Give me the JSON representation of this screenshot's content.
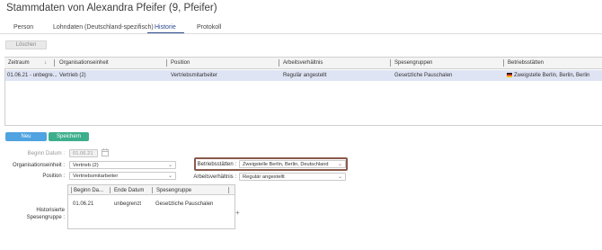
{
  "header": {
    "title": "Stammdaten von Alexandra Pfeifer (9, Pfeifer)"
  },
  "tabs": [
    {
      "label": "Person",
      "active": false
    },
    {
      "label": "Lohndaten (Deutschland-spezifisch)",
      "active": false
    },
    {
      "label": "Historie",
      "active": true
    },
    {
      "label": "Protokoll",
      "active": false
    }
  ],
  "toolbar": {
    "delete_label": "Löschen"
  },
  "grid": {
    "columns": [
      "Zeitraum",
      "Organisationseinheit",
      "Position",
      "Arbeitsverhältnis",
      "Spesengruppen",
      "Betriebsstätten"
    ],
    "sort_icon": "↓",
    "rows": [
      [
        "01.06.21 - unbegre...",
        "Vertrieb (2)",
        "Vertriebsmitarbeiter",
        "Regulär angestellt",
        "Gesetzliche Pauschalen",
        "Zweigstelle Berlin, Berlin, Berlin"
      ]
    ],
    "row_flag": "germany-flag-icon"
  },
  "actions": {
    "new_label": "Neu",
    "save_label": "Speichern"
  },
  "form": {
    "begin_label": "Beginn Datum :",
    "begin_value": "01.06.21",
    "org_label": "Organisationseinheit :",
    "org_value": "Vertrieb (2)",
    "position_label": "Position :",
    "position_value": "Vertriebsmitarbeiter",
    "betrieb_label": "Betriebsstätten :",
    "betrieb_value": "Zweigstelle Berlin, Berlin, Deutschland",
    "arbeit_label": "Arbeitsverhältnis :",
    "arbeit_value": "Regulär angestellt",
    "spesen_label_1": "Historisierte",
    "spesen_label_2": "Spesengruppe :"
  },
  "subgrid": {
    "columns": [
      "Beginn Da...",
      "Ende Datum",
      "Spesengruppe"
    ],
    "row": [
      "01.06.21",
      "unbegrenzt",
      "Gesetzliche Pauschalen"
    ],
    "add_symbol": "+"
  },
  "colors": {
    "accent_blue": "#4fa3e0",
    "accent_green": "#3dae8c",
    "selected_row": "#dfe4f4",
    "tab_active": "#2b4a8b",
    "highlight_border": "#8a5a4c"
  }
}
